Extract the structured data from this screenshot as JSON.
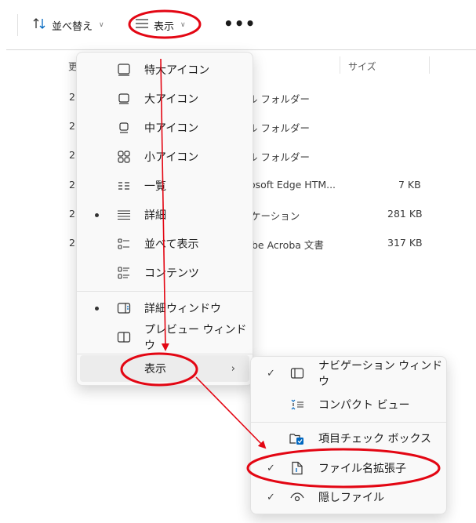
{
  "toolbar": {
    "sort_label": "並べ替え",
    "view_label": "表示",
    "more_label": "•••"
  },
  "file_list": {
    "headers": {
      "date": "更",
      "size": "サイズ"
    },
    "rows": [
      {
        "date": "2",
        "type": "ル フォルダー",
        "size": ""
      },
      {
        "date": "2",
        "type": "ル フォルダー",
        "size": ""
      },
      {
        "date": "2",
        "type": "ル フォルダー",
        "size": ""
      },
      {
        "date": "2",
        "type": "osoft Edge HTM...",
        "size": "7 KB"
      },
      {
        "date": "2",
        "type": "ケーション",
        "size": "281 KB"
      },
      {
        "date": "2",
        "type": "be Acroba 文書",
        "size": "317 KB"
      }
    ]
  },
  "view_menu": {
    "items": [
      {
        "label": "特大アイコン",
        "icon": "extra-large-icons-icon",
        "selected": false
      },
      {
        "label": "大アイコン",
        "icon": "large-icons-icon",
        "selected": false
      },
      {
        "label": "中アイコン",
        "icon": "medium-icons-icon",
        "selected": false
      },
      {
        "label": "小アイコン",
        "icon": "small-icons-icon",
        "selected": false
      },
      {
        "label": "一覧",
        "icon": "list-icon",
        "selected": false
      },
      {
        "label": "詳細",
        "icon": "details-icon",
        "selected": true
      },
      {
        "label": "並べて表示",
        "icon": "tiles-icon",
        "selected": false
      },
      {
        "label": "コンテンツ",
        "icon": "content-icon",
        "selected": false
      },
      {
        "label": "詳細ウィンドウ",
        "icon": "details-pane-icon",
        "selected": true
      },
      {
        "label": "プレビュー ウィンドウ",
        "icon": "preview-pane-icon",
        "selected": false
      },
      {
        "label": "表示",
        "icon": "",
        "selected": false
      }
    ]
  },
  "show_submenu": {
    "items": [
      {
        "label": "ナビゲーション ウィンドウ",
        "icon": "navigation-pane-icon",
        "checked": true
      },
      {
        "label": "コンパクト ビュー",
        "icon": "compact-view-icon",
        "checked": false
      },
      {
        "label": "項目チェック ボックス",
        "icon": "item-checkbox-icon",
        "checked": false
      },
      {
        "label": "ファイル名拡張子",
        "icon": "file-extension-icon",
        "checked": true
      },
      {
        "label": "隠しファイル",
        "icon": "hidden-files-icon",
        "checked": true
      }
    ]
  },
  "colors": {
    "annotation_red": "#e30613",
    "accent_blue": "#0067c0"
  }
}
